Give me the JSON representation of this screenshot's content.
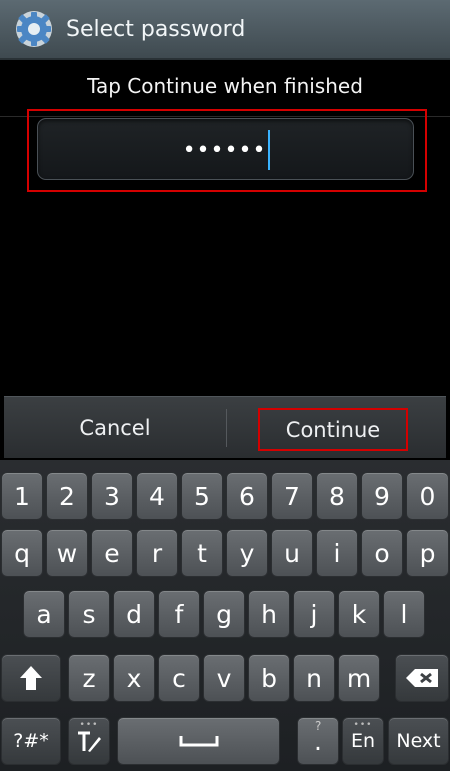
{
  "titlebar": {
    "title": "Select password",
    "icon": "gear-icon"
  },
  "instruction": "Tap Continue when finished",
  "password_field": {
    "masked_value": "••••••"
  },
  "actions": {
    "cancel_label": "Cancel",
    "continue_label": "Continue"
  },
  "keyboard": {
    "row1": [
      "1",
      "2",
      "3",
      "4",
      "5",
      "6",
      "7",
      "8",
      "9",
      "0"
    ],
    "row2": [
      "q",
      "w",
      "e",
      "r",
      "t",
      "y",
      "u",
      "i",
      "o",
      "p"
    ],
    "row3": [
      "a",
      "s",
      "d",
      "f",
      "g",
      "h",
      "j",
      "k",
      "l"
    ],
    "row4": [
      "z",
      "x",
      "c",
      "v",
      "b",
      "n",
      "m"
    ],
    "sym_label": "?#*",
    "en_label": "En",
    "next_label": "Next",
    "period_label": ".",
    "period_sup": "?",
    "dots": "•••"
  },
  "colors": {
    "highlight": "#d40000",
    "cursor": "#3ab3ff"
  }
}
